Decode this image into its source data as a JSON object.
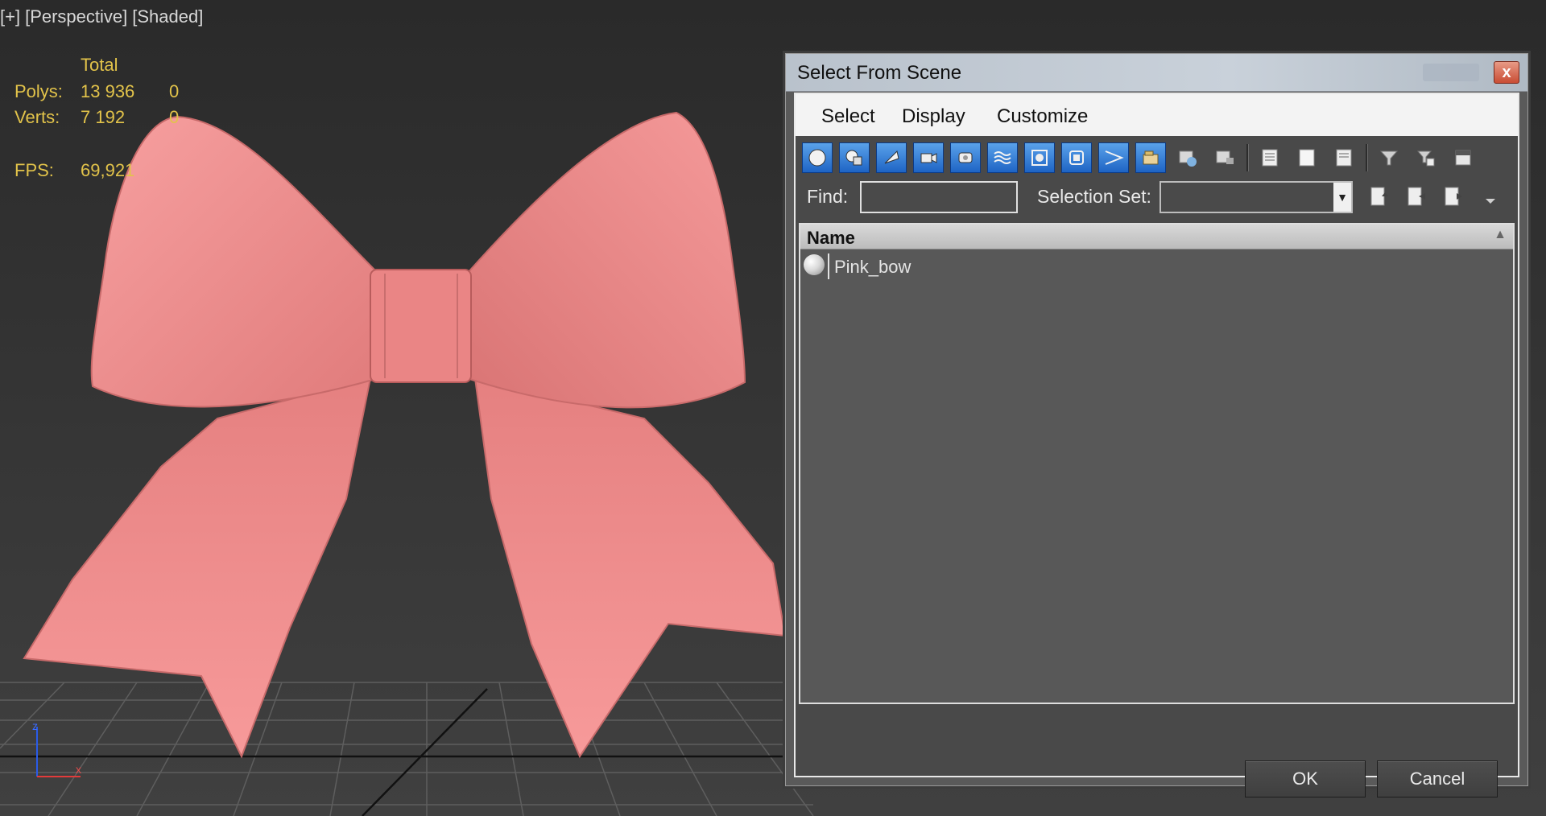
{
  "viewport": {
    "labels": [
      "[+]",
      "[Perspective]",
      "[Shaded]"
    ],
    "stats": {
      "header": "Total",
      "polys_label": "Polys:",
      "polys_total": "13 936",
      "polys_selected": "0",
      "verts_label": "Verts:",
      "verts_total": "7 192",
      "verts_selected": "0",
      "fps_label": "FPS:",
      "fps_value": "69,921"
    },
    "axis": {
      "z_label": "z",
      "x_label": "x"
    },
    "object_color": "#f48c8c"
  },
  "dialog": {
    "title": "Select From Scene",
    "close_glyph": "x",
    "menu": [
      "Select",
      "Display",
      "Customize"
    ],
    "toolbar_icons": [
      "geometry-icon",
      "shapes-icon",
      "lights-icon",
      "cameras-icon",
      "helpers-icon",
      "space-warps-icon",
      "groups-icon",
      "xrefs-icon",
      "bones-icon",
      "containers-icon",
      "frozen-icon",
      "hidden-icon",
      "list-all-icon",
      "list-none-icon",
      "list-invert-icon",
      "filter-icon",
      "filter-options-icon",
      "display-children-icon"
    ],
    "find_label": "Find:",
    "find_value": "",
    "selection_set_label": "Selection Set:",
    "list": {
      "column_header": "Name",
      "rows": [
        "Pink_bow"
      ]
    },
    "ok_label": "OK",
    "cancel_label": "Cancel"
  }
}
